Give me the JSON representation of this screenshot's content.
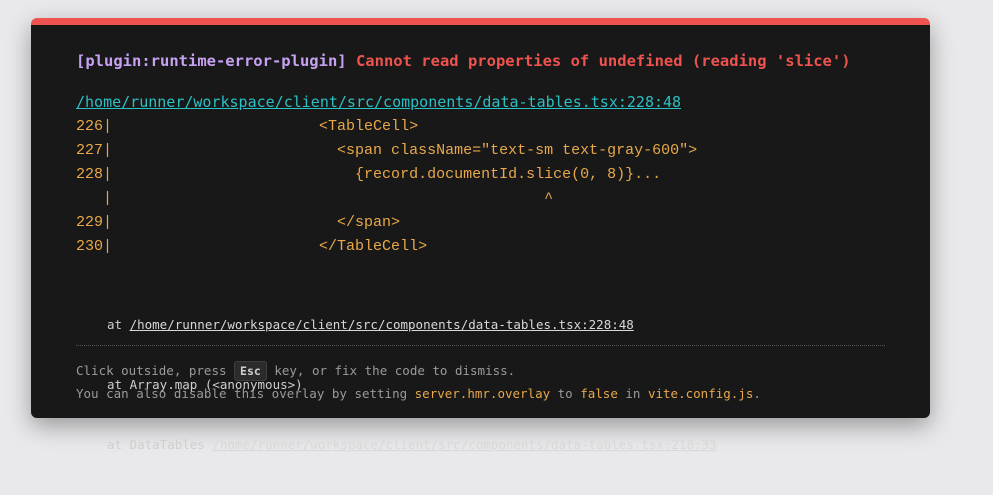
{
  "error": {
    "plugin": "[plugin:runtime-error-plugin]",
    "message": "Cannot read properties of undefined (reading 'slice')",
    "file": "/home/runner/workspace/client/src/components/data-tables.tsx:228:48"
  },
  "code_frame": {
    "lines": [
      {
        "gutter": "226|",
        "code": "                       <TableCell>"
      },
      {
        "gutter": "227|",
        "code": "                         <span className=\"text-sm text-gray-600\">"
      },
      {
        "gutter": "228|",
        "code": "                           {record.documentId.slice(0, 8)}..."
      },
      {
        "gutter": "   |",
        "code": "                                                ^"
      },
      {
        "gutter": "229|",
        "code": "                         </span>"
      },
      {
        "gutter": "230|",
        "code": "                       </TableCell>"
      }
    ]
  },
  "stack": [
    {
      "prefix": "at ",
      "path": "/home/runner/workspace/client/src/components/data-tables.tsx:228:48"
    },
    {
      "prefix": "at Array.map (<anonymous>)",
      "path": ""
    },
    {
      "prefix": "at DataTables ",
      "path": "/home/runner/workspace/client/src/components/data-tables.tsx:218:33"
    }
  ],
  "tips": {
    "line1_before": "Click outside, press ",
    "esc_key": "Esc",
    "line1_after": " key, or fix the code to dismiss.",
    "line2_before": "You can also disable this overlay by setting ",
    "setting": "server.hmr.overlay",
    "line2_mid": " to ",
    "value": "false",
    "line2_mid2": " in ",
    "config_file": "vite.config.js",
    "line2_end": "."
  },
  "colors": {
    "accent_border": "#ef5350",
    "plugin": "#c7a1f2",
    "error": "#ef5350",
    "link": "#2bc0c4",
    "code": "#e8a84a"
  }
}
